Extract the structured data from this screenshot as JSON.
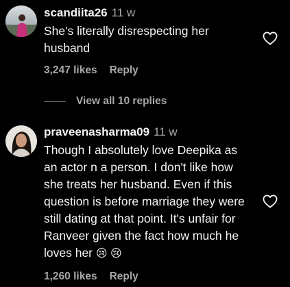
{
  "comments": [
    {
      "username": "scandiita26",
      "time": "11 w",
      "text": "She's literally disrespecting her husband",
      "likes": "3,247 likes",
      "reply_label": "Reply",
      "avatar_icon": "user-avatar-photo",
      "like_icon": "heart-outline-icon"
    },
    {
      "username": "praveenasharma09",
      "time": "11 w",
      "text": "Though I absolutely love Deepika as an actor n a person. I don't like how she treats her husband. Even if this question is before marriage they were still dating at that point. It's unfair for Ranveer given the fact how much he loves her",
      "emojis": "😢 😢",
      "likes": "1,260 likes",
      "reply_label": "Reply",
      "avatar_icon": "user-avatar-photo",
      "like_icon": "heart-outline-icon"
    }
  ],
  "view_replies": "View all 10 replies",
  "colors": {
    "background": "#000000",
    "primary_text": "#f5f5f5",
    "secondary_text": "#a8a8a8"
  }
}
